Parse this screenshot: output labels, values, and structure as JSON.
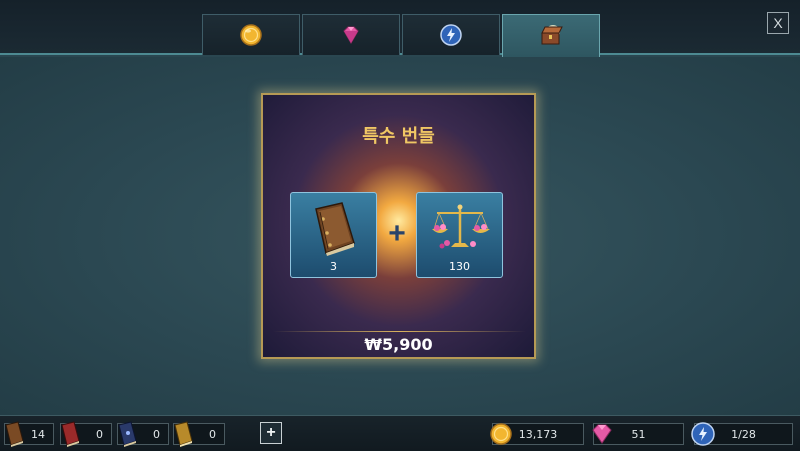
{
  "tabs": [
    {
      "icon": "gold-coin-icon"
    },
    {
      "icon": "pink-gem-icon"
    },
    {
      "icon": "energy-orb-icon"
    },
    {
      "icon": "treasure-chest-icon",
      "active": true
    }
  ],
  "close_label": "X",
  "bundle": {
    "title": "특수 번들",
    "items": [
      {
        "icon": "brown-book-icon",
        "count": "3"
      },
      {
        "icon": "balance-scale-icon",
        "count": "130"
      }
    ],
    "plus": "+",
    "price": "₩5,900"
  },
  "inventory": {
    "brown_book": "14",
    "red_book": "0",
    "blue_book": "0",
    "gold_book": "0",
    "add_label": "+"
  },
  "currencies": {
    "gold": "13,173",
    "gems": "51",
    "energy": "1/28"
  }
}
